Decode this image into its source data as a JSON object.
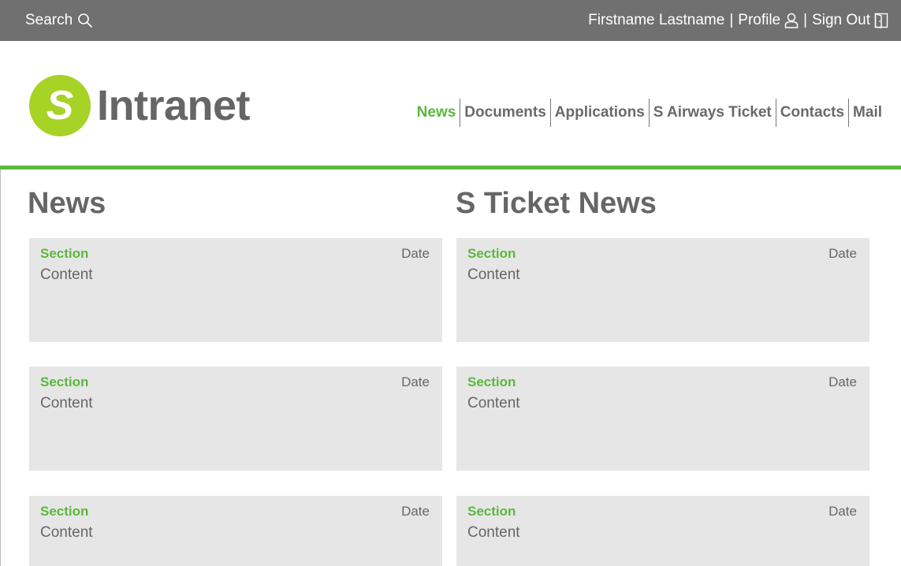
{
  "topbar": {
    "search_label": "Search",
    "user_name": "Firstname Lastname",
    "profile_label": "Profile",
    "signout_label": "Sign Out",
    "separator": "|"
  },
  "header": {
    "logo_letter": "S",
    "logo_text": "Intranet",
    "nav": [
      {
        "label": "News",
        "active": true
      },
      {
        "label": "Documents"
      },
      {
        "label": "Applications"
      },
      {
        "label": "S Airways Ticket"
      },
      {
        "label": "Contacts"
      },
      {
        "label": "Mail"
      }
    ]
  },
  "columns": [
    {
      "title": "News",
      "cards": [
        {
          "section": "Section",
          "date": "Date",
          "content": "Content"
        },
        {
          "section": "Section",
          "date": "Date",
          "content": "Content"
        },
        {
          "section": "Section",
          "date": "Date",
          "content": "Content"
        }
      ]
    },
    {
      "title": "S Ticket News",
      "cards": [
        {
          "section": "Section",
          "date": "Date",
          "content": "Content"
        },
        {
          "section": "Section",
          "date": "Date",
          "content": "Content"
        },
        {
          "section": "Section",
          "date": "Date",
          "content": "Content"
        }
      ]
    }
  ],
  "colors": {
    "topbar_bg": "#707070",
    "accent_green": "#5bb83c",
    "logo_green": "#a7d226",
    "card_bg": "#e6e6e6",
    "text_gray": "#666666"
  }
}
